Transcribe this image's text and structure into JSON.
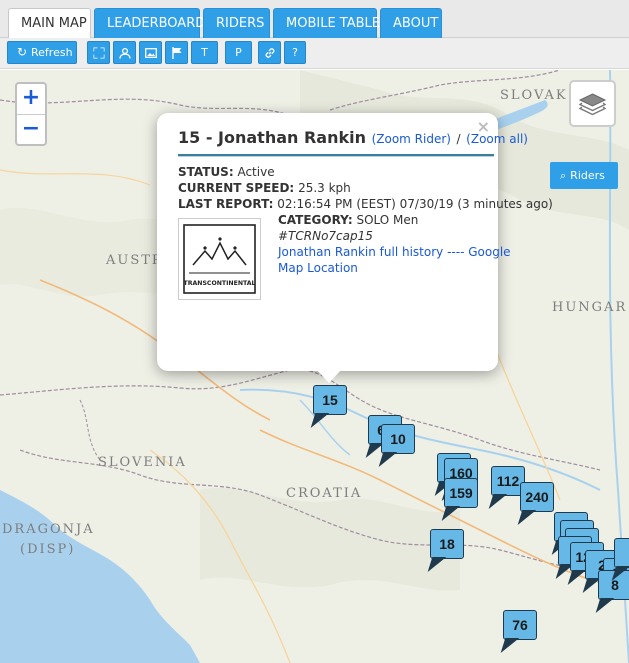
{
  "tabs": [
    {
      "label": "MAIN MAP",
      "active": true
    },
    {
      "label": "LEADERBOARD",
      "active": false
    },
    {
      "label": "RIDERS",
      "active": false
    },
    {
      "label": "MOBILE TABLE",
      "active": false
    },
    {
      "label": "ABOUT",
      "active": false
    }
  ],
  "toolbar": {
    "refresh_label": "Refresh",
    "t_label": "T",
    "p_label": "P",
    "help_label": "?",
    "icons": [
      "refresh-icon",
      "fullscreen-icon",
      "person-icon",
      "image-icon",
      "flag-icon",
      "link-icon"
    ]
  },
  "map": {
    "countries": [
      "SLOVAK",
      "AUSTR",
      "HUNGAR",
      "SLOVENIA",
      "CROATIA",
      "DRAGONJA",
      "(DISP)"
    ],
    "riders_button": "Riders",
    "zoom_in": "+",
    "zoom_out": "−",
    "colors": {
      "water": "#a9d1ee",
      "land": "#eef0e6",
      "marker": "#66b8e6",
      "accent": "#2f9fe8"
    }
  },
  "markers": [
    "15",
    "66",
    "10",
    "160",
    "159",
    "112",
    "240",
    "18",
    "76",
    "2",
    "88",
    "8",
    "127"
  ],
  "popup": {
    "rider_number": "15",
    "rider_name": "Jonathan Rankin",
    "title": "15 - Jonathan Rankin",
    "zoom_rider": "(Zoom Rider)",
    "separator": "/",
    "zoom_all": "(Zoom all)",
    "close": "×",
    "status_label": "STATUS:",
    "status_value": "Active",
    "speed_label": "CURRENT SPEED:",
    "speed_value": "25.3 kph",
    "report_label": "LAST REPORT:",
    "report_value": "02:16:54 PM (EEST) 07/30/19 (3 minutes ago)",
    "category_label": "CATEGORY:",
    "category_value": "SOLO Men",
    "hashtag": "#TCRNo7cap15",
    "history_link": "Jonathan Rankin full history",
    "dashes": "----",
    "google_link": "Google",
    "map_location": "Map Location",
    "badge_text": "TRANSCONTINENTAL"
  }
}
